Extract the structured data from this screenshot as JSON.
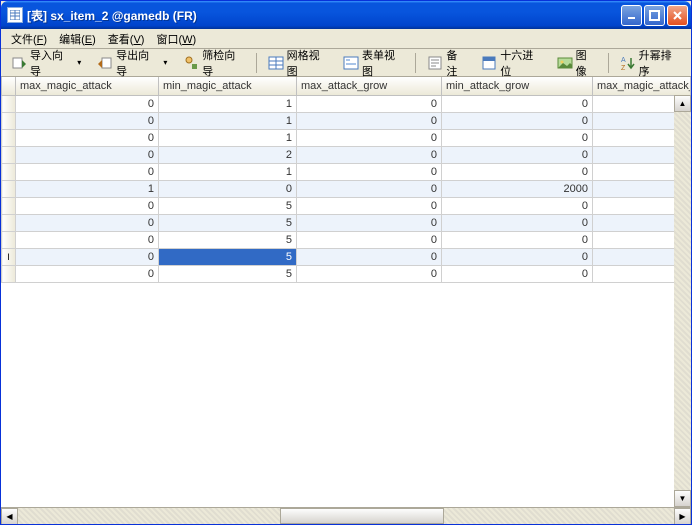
{
  "title": "[表] sx_item_2 @gamedb (FR)",
  "menu": {
    "file": "文件",
    "file_u": "F",
    "edit": "编辑",
    "edit_u": "E",
    "view": "查看",
    "view_u": "V",
    "window": "窗口",
    "window_u": "W"
  },
  "toolbar": {
    "import_wizard": "导入向导",
    "export_wizard": "导出向导",
    "filter_wizard": "筛检向导",
    "grid_view": "网格视图",
    "form_view": "表单视图",
    "note": "备注",
    "hex": "十六进位",
    "image": "图像",
    "sort_asc": "升幂排序"
  },
  "columns": [
    "max_magic_attack",
    "min_magic_attack",
    "max_attack_grow",
    "min_attack_grow",
    "max_magic_attack_g"
  ],
  "rows": [
    {
      "v": [
        0,
        1,
        0,
        0
      ]
    },
    {
      "v": [
        0,
        1,
        0,
        0
      ]
    },
    {
      "v": [
        0,
        1,
        0,
        0
      ]
    },
    {
      "v": [
        0,
        2,
        0,
        0
      ]
    },
    {
      "v": [
        0,
        1,
        0,
        0
      ]
    },
    {
      "v": [
        1,
        0,
        0,
        2000
      ]
    },
    {
      "v": [
        0,
        5,
        0,
        0
      ]
    },
    {
      "v": [
        0,
        5,
        0,
        0
      ]
    },
    {
      "v": [
        0,
        5,
        0,
        0
      ]
    },
    {
      "v": [
        0,
        5,
        0,
        0
      ],
      "current": true,
      "selected_col": 1
    },
    {
      "v": [
        0,
        5,
        0,
        0
      ]
    }
  ],
  "current_marker": "I"
}
